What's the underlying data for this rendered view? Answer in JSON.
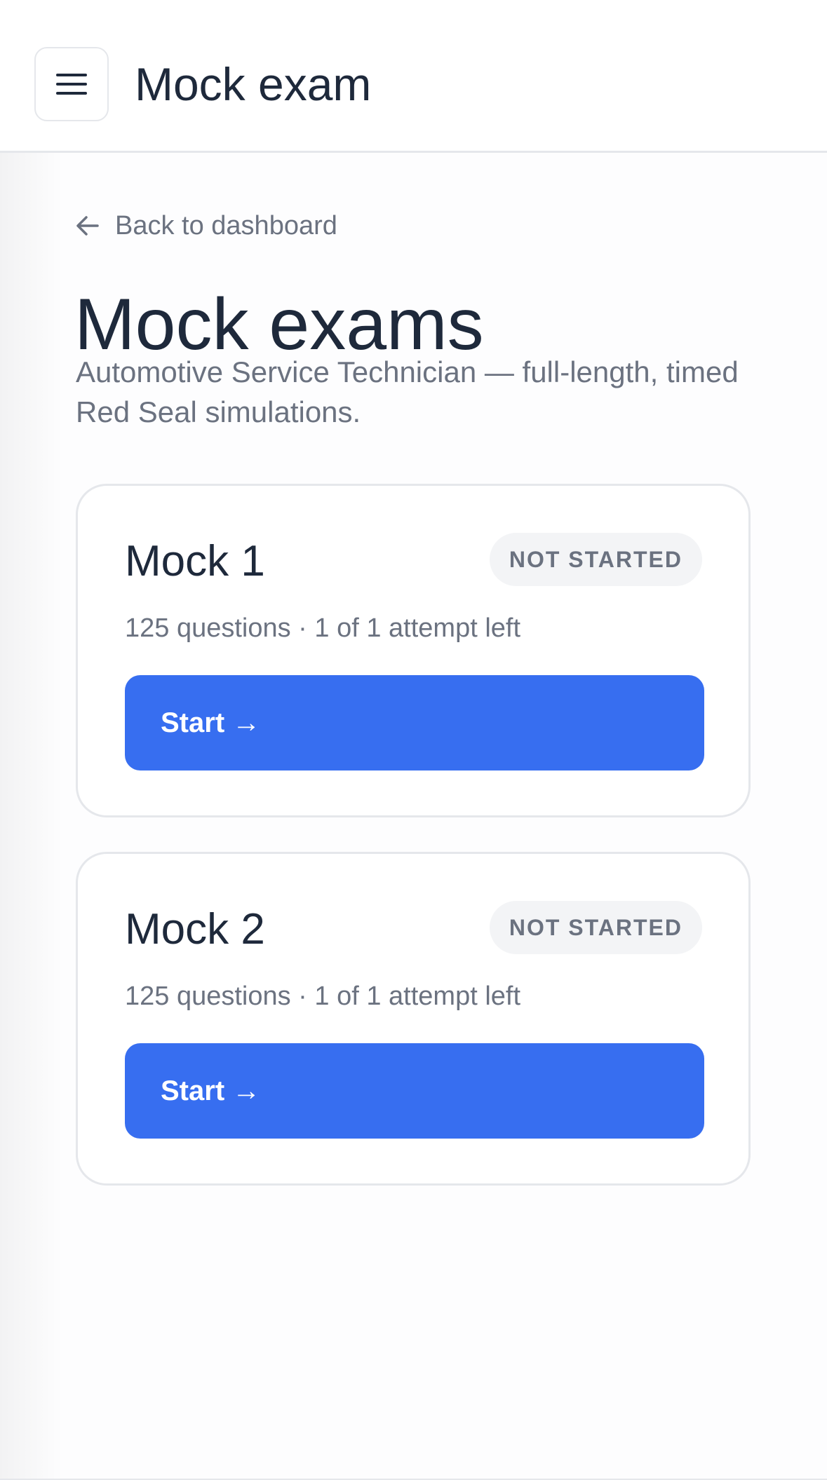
{
  "header": {
    "menu_icon": "hamburger-menu-icon",
    "title": "Mock exam"
  },
  "back_link": {
    "icon": "arrow-left-icon",
    "label": "Back to dashboard"
  },
  "main": {
    "title": "Mock exams",
    "subtitle": "Automotive Service Technician — full-length, timed Red Seal simulations."
  },
  "exams": [
    {
      "title": "Mock 1",
      "status": "NOT STARTED",
      "meta": "125 questions · 1 of 1 attempt left",
      "button_label": "Start →"
    },
    {
      "title": "Mock 2",
      "status": "NOT STARTED",
      "meta": "125 questions · 1 of 1 attempt left",
      "button_label": "Start →"
    }
  ],
  "colors": {
    "primary": "#376ef0",
    "text_dark": "#1e293b",
    "text_muted": "#6b7280",
    "border": "#e5e7eb",
    "badge_bg": "#f3f4f6"
  }
}
